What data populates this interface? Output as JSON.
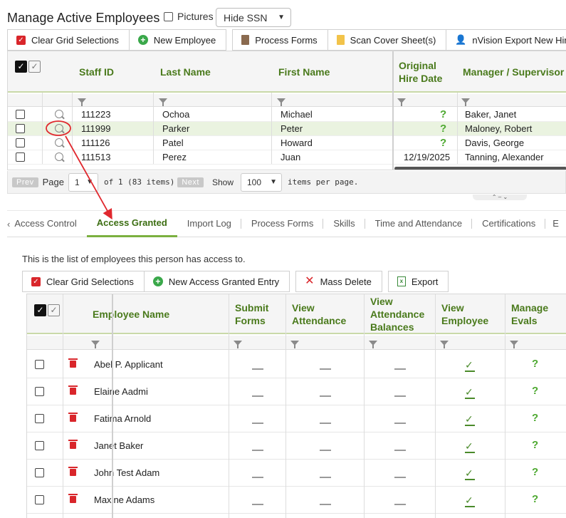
{
  "header": {
    "title": "Manage Active Employees",
    "pictures_label": "Pictures",
    "ssn_select": "Hide SSN"
  },
  "toolbar1": {
    "clear": "Clear Grid Selections",
    "new_employee": "New Employee",
    "process_forms": "Process Forms",
    "scan_cover": "Scan Cover Sheet(s)",
    "nvision": "nVision Export New Hir"
  },
  "grid1": {
    "columns": [
      "Staff ID",
      "Last Name",
      "First Name",
      "Original Hire Date",
      "Manager / Supervisor"
    ],
    "rows": [
      {
        "staff_id": "111223",
        "last": "Ochoa",
        "first": "Michael",
        "hire": "?",
        "manager": "Baker, Janet"
      },
      {
        "staff_id": "111999",
        "last": "Parker",
        "first": "Peter",
        "hire": "?",
        "manager": "Maloney, Robert"
      },
      {
        "staff_id": "111126",
        "last": "Patel",
        "first": "Howard",
        "hire": "?",
        "manager": "Davis, George"
      },
      {
        "staff_id": "111513",
        "last": "Perez",
        "first": "Juan",
        "hire": "12/19/2025",
        "manager": "Tanning, Alexander"
      }
    ]
  },
  "pager": {
    "prev": "Prev",
    "page_label": "Page",
    "page_value": "1",
    "of_text": "of 1 (83 items)",
    "next": "Next",
    "show": "Show",
    "per_page_value": "100",
    "per_page_label": "items per page."
  },
  "tabs": [
    "Access Control",
    "Access Granted",
    "Import Log",
    "Process Forms",
    "Skills",
    "Time and Attendance",
    "Certifications",
    "E"
  ],
  "active_tab": "Access Granted",
  "intro": "This is the list of employees this person has access to.",
  "toolbar2": {
    "clear": "Clear Grid Selections",
    "new_entry": "New Access Granted Entry",
    "mass_delete": "Mass Delete",
    "export": "Export"
  },
  "grid2": {
    "columns": [
      "Employee Name",
      "Submit Forms",
      "View Attendance",
      "View Attendance Balances",
      "View Employee",
      "Manage Evals"
    ],
    "rows": [
      {
        "name": "Abel P. Applicant"
      },
      {
        "name": "Elaine Aadmi"
      },
      {
        "name": "Fatima Arnold"
      },
      {
        "name": "Janet Baker"
      },
      {
        "name": "John Test Adam"
      },
      {
        "name": "Maxine Adams"
      }
    ]
  },
  "colors": {
    "accent_green": "#4a7a1c",
    "annotation_red": "#e0282e"
  }
}
